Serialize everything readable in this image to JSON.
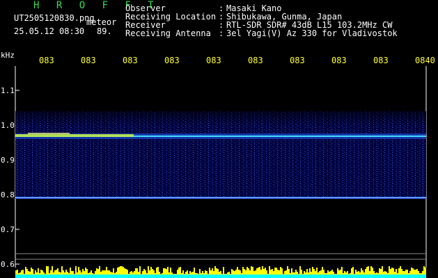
{
  "header": {
    "title": "H R O F F T",
    "file_name": "UT2505120830.png",
    "meteor_label": "meteor",
    "date_time": "25.05.12 08:30",
    "meteor_count": "89."
  },
  "info": [
    {
      "label": "Observer",
      "value": "Masaki Kano"
    },
    {
      "label": "Receiving Location",
      "value": "Shibukawa, Gunma, Japan"
    },
    {
      "label": "Receiver",
      "value": "RTL-SDR SDR# 43dB L15 103.2MHz CW"
    },
    {
      "label": "Receiving Antenna",
      "value": "3el Yagi(V) Az 330 for Vladivostok"
    }
  ],
  "axis": {
    "y_unit": "kHz",
    "y_ticks": [
      "1.1",
      "1.0",
      "0.9",
      "0.8",
      "0.7",
      "0.6"
    ],
    "x_ticks": [
      "083",
      "083",
      "083",
      "083",
      "083",
      "083",
      "083",
      "083",
      "083",
      "0840"
    ]
  },
  "colors": {
    "background": "#000000",
    "spectrogram_bg": "#000033",
    "text_white": "#ffffff",
    "text_green": "#33dd55",
    "text_yellow": "#ffff40",
    "bar_yellow": "#ffff00",
    "bar_cyan": "#00ffff"
  }
}
